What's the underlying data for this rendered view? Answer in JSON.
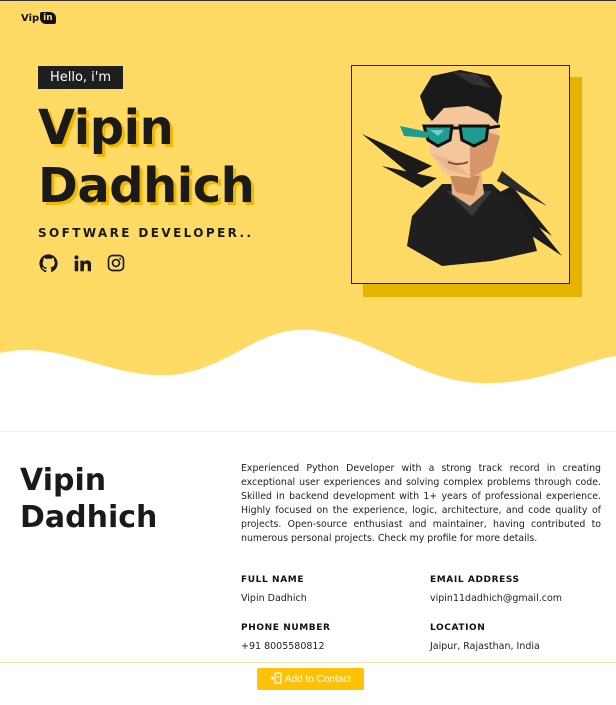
{
  "brand": {
    "logo_text_a": "Vip",
    "logo_text_b": "in"
  },
  "hero": {
    "greeting": "Hello, i'm",
    "first_name": "Vipin",
    "last_name": "Dadhich",
    "role": "SOFTWARE DEVELOPER..",
    "socials": [
      {
        "icon": "github-icon"
      },
      {
        "icon": "linkedin-icon"
      },
      {
        "icon": "instagram-icon"
      }
    ]
  },
  "about": {
    "first_name": "Vipin",
    "last_name": "Dadhich",
    "bio": "Experienced Python Developer with a strong track record in creating exceptional user experiences and solving complex problems through code. Skilled in backend development with 1+ years of professional experience. Highly focused on the experience, logic, architecture, and code quality of projects. Open-source enthusiast and maintainer, having contributed to numerous personal projects. Check my profile for more details.",
    "details": {
      "full_name_label": "FULL NAME",
      "full_name": "Vipin Dadhich",
      "email_label": "EMAIL ADDRESS",
      "email": "vipin11dadhich@gmail.com",
      "phone_label": "PHONE NUMBER",
      "phone": "+91 8005580812",
      "location_label": "LOCATION",
      "location": "Jaipur, Rajasthan, India"
    }
  },
  "actions": {
    "add_contact_label": "Add to Contact",
    "add_contact_icon": "add-contact-icon"
  },
  "colors": {
    "accent": "#ffdb66",
    "shadow": "#f2b705",
    "button": "#ffc107",
    "dark": "#1f1f1f"
  }
}
